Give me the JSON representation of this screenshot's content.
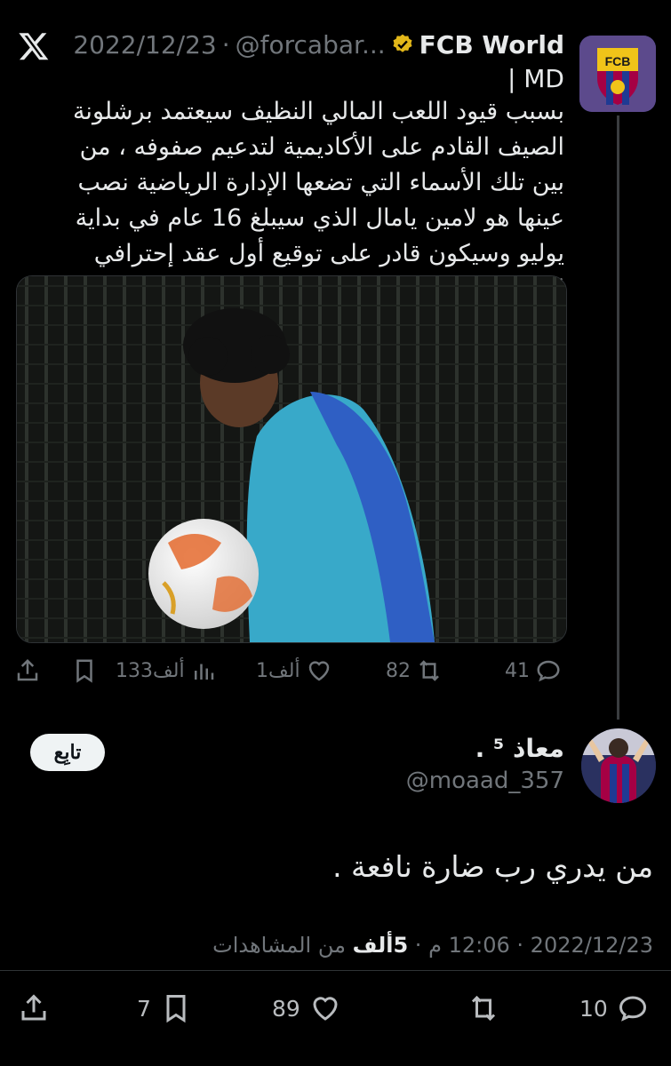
{
  "quoted": {
    "author_name": "FCB World",
    "author_suffix": "| MD",
    "handle": "@forcabar...",
    "separator": "·",
    "date": "2022/12/23",
    "text": "بسبب قيود اللعب المالي النظيف سيعتمد برشلونة الصيف القادم على الأكاديمية لتدعيم صفوفه ، من بين تلك الأسماء التي تضعها الإدارة الرياضية نصب عينها هو لامين يامال الذي سيبلغ 16 عام في بداية يوليو وسيكون قادر على توقيع أول عقد إحترافي له",
    "avatar_text": "FCB",
    "stats": {
      "replies": "41",
      "reposts": "82",
      "likes": "1ألف",
      "views": "133ألف"
    }
  },
  "reply": {
    "author_name": "معاذ ⁵ .",
    "handle": "@moaad_357",
    "follow_label": "تابِع",
    "text": "من يدري رب ضارة نافعة .",
    "meta": {
      "date": "2022/12/23",
      "sep1": "·",
      "time": "12:06 م",
      "sep2": "·",
      "views_count": "5ألف",
      "views_label": "من المشاهدات"
    },
    "stats": {
      "replies": "10",
      "likes": "89",
      "bookmarks": "7"
    }
  },
  "colors": {
    "background": "#000000",
    "text": "#e7e9ea",
    "muted": "#71767b",
    "verified_gold": "#e2b719",
    "avatar_blue": "#1a2a6b",
    "avatar_red": "#a50044"
  },
  "icons": [
    "x-logo-icon",
    "verified-badge-icon",
    "reply-icon",
    "repost-icon",
    "like-icon",
    "views-icon",
    "bookmark-icon",
    "share-icon"
  ]
}
